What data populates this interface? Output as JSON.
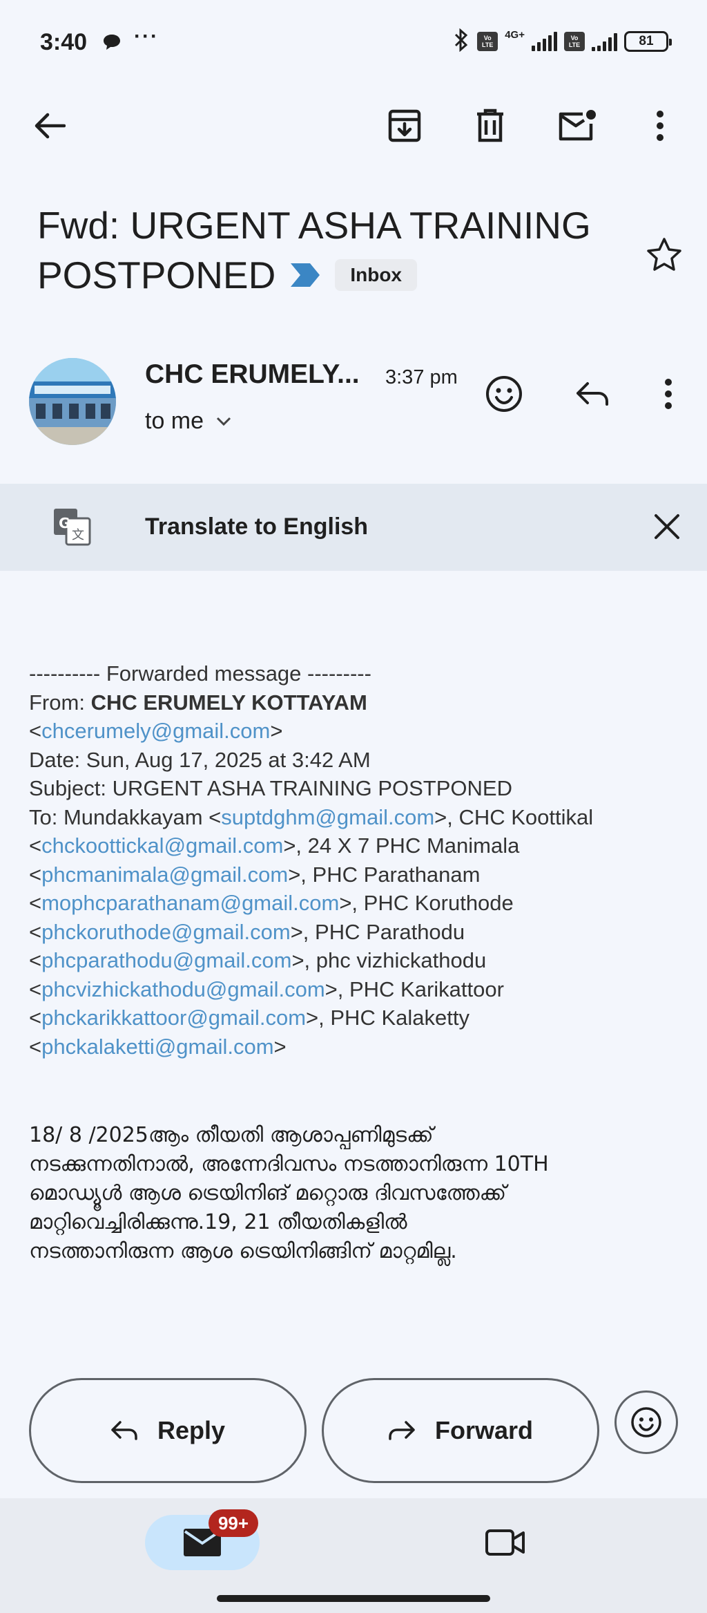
{
  "status_bar": {
    "time": "3:40",
    "dots": "···",
    "network_type": "4G+",
    "lte_label_top": "Vo",
    "lte_label_bottom": "LTE",
    "battery": "81"
  },
  "toolbar": {
    "icons": [
      "back-arrow-icon",
      "archive-icon",
      "delete-icon",
      "mark-unread-icon",
      "more-vert-icon"
    ]
  },
  "subject": {
    "line1": "Fwd: URGENT ASHA TRAINING",
    "line2": "POSTPONED",
    "label": "Inbox"
  },
  "sender": {
    "name": "CHC ERUMELY...",
    "time": "3:37 pm",
    "to": "to me"
  },
  "translate": {
    "label": "Translate to English"
  },
  "email": {
    "forward_header": "---------- Forwarded message ---------",
    "from_label": "From: ",
    "from_name": "CHC ERUMELY KOTTAYAM",
    "from_lt": "<",
    "from_email": "chcerumely@gmail.com",
    "from_gt": ">",
    "date": "Date: Sun, Aug 17, 2025 at 3:42 AM",
    "subject": "Subject: URGENT ASHA TRAINING POSTPONED",
    "to_lines": [
      {
        "pre": "To: Mundakkayam <",
        "email": "suptdghm@gmail.com",
        "post": ">, CHC Koottikal"
      },
      {
        "pre": "<",
        "email": "chckoottickal@gmail.com",
        "post": ">, 24 X 7 PHC Manimala"
      },
      {
        "pre": "<",
        "email": "phcmanimala@gmail.com",
        "post": ">, PHC Parathanam"
      },
      {
        "pre": "<",
        "email": "mophcparathanam@gmail.com",
        "post": ">, PHC Koruthode"
      },
      {
        "pre": "<",
        "email": "phckoruthode@gmail.com",
        "post": ">, PHC Parathodu"
      },
      {
        "pre": "<",
        "email": "phcparathodu@gmail.com",
        "post": ">, phc vizhickathodu"
      },
      {
        "pre": "<",
        "email": "phcvizhickathodu@gmail.com",
        "post": ">, PHC Karikattoor"
      },
      {
        "pre": "<",
        "email": "phckarikkattoor@gmail.com",
        "post": ">, PHC Kalaketty"
      },
      {
        "pre": "<",
        "email": "phckalaketti@gmail.com",
        "post": ">"
      }
    ],
    "body_lines": [
      "18/ 8 /2025ആം തീയതി ആശാപ്പണിമുടക്ക്",
      "നടക്കുന്നതിനാൽ, അന്നേദിവസം നടത്താനിരുന്ന 10TH",
      "മൊഡ്യൂൾ  ആശ ട്രെയിനിങ്  മറ്റൊരു ദിവസത്തേക്ക്",
      " മാറ്റിവെച്ചിരിക്കുന്നു.19, 21 തീയതികളിൽ",
      "നടത്താനിരുന്ന ആശ ട്രെയിനിങ്ങിന് മാറ്റമില്ല."
    ]
  },
  "actions": {
    "reply_label": "Reply",
    "forward_label": "Forward"
  },
  "bottom_nav": {
    "unread_badge": "99+"
  },
  "colors": {
    "background": "#f3f6fc",
    "link": "#4f92c8",
    "translate_bar": "#e3e9f1",
    "mail_tab_active": "#c9e5fc",
    "badge": "#b3261e",
    "importance_marker": "#3b86c4"
  }
}
